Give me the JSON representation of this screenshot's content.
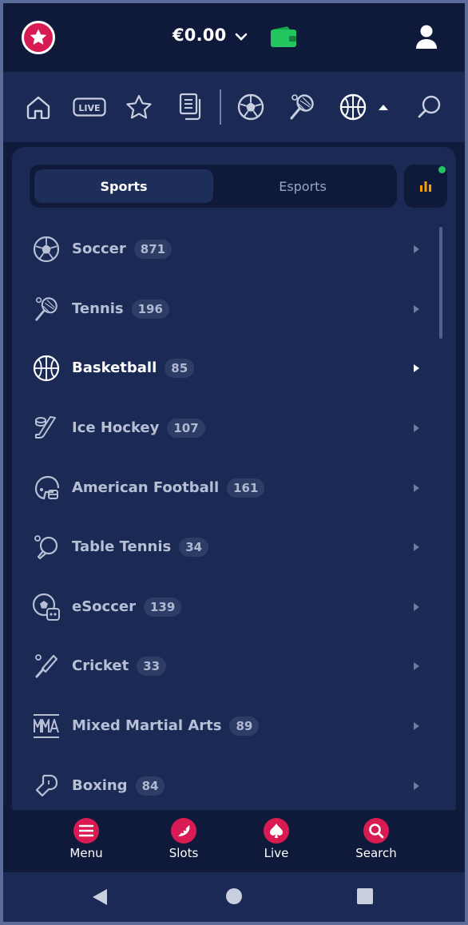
{
  "header": {
    "balance": "€0.00",
    "wallet_color": "#22c55e",
    "brand_color": "#d81b52"
  },
  "sport_nav": {
    "items": [
      "home-icon",
      "live-icon",
      "favorites-star-icon",
      "betslip-icon",
      "soccer-icon",
      "tennis-icon",
      "basketball-icon",
      "search-icon"
    ],
    "live_label": "LIVE"
  },
  "segments": {
    "active": "Sports",
    "other": "Esports"
  },
  "sports": [
    {
      "name": "Soccer",
      "count": "871",
      "icon": "soccer-ball-icon"
    },
    {
      "name": "Tennis",
      "count": "196",
      "icon": "tennis-racket-icon"
    },
    {
      "name": "Basketball",
      "count": "85",
      "icon": "basketball-icon",
      "active": true
    },
    {
      "name": "Ice Hockey",
      "count": "107",
      "icon": "ice-hockey-icon"
    },
    {
      "name": "American Football",
      "count": "161",
      "icon": "football-helmet-icon"
    },
    {
      "name": "Table Tennis",
      "count": "34",
      "icon": "table-tennis-icon"
    },
    {
      "name": "eSoccer",
      "count": "139",
      "icon": "esoccer-icon"
    },
    {
      "name": "Cricket",
      "count": "33",
      "icon": "cricket-bat-icon"
    },
    {
      "name": "Mixed Martial Arts",
      "count": "89",
      "icon": "mma-icon"
    },
    {
      "name": "Boxing",
      "count": "84",
      "icon": "boxing-glove-icon"
    }
  ],
  "bottom_nav": [
    {
      "label": "Menu",
      "icon": "menu-icon"
    },
    {
      "label": "Slots",
      "icon": "slots-icon"
    },
    {
      "label": "Live",
      "icon": "spade-icon"
    },
    {
      "label": "Search",
      "icon": "search-icon"
    }
  ]
}
